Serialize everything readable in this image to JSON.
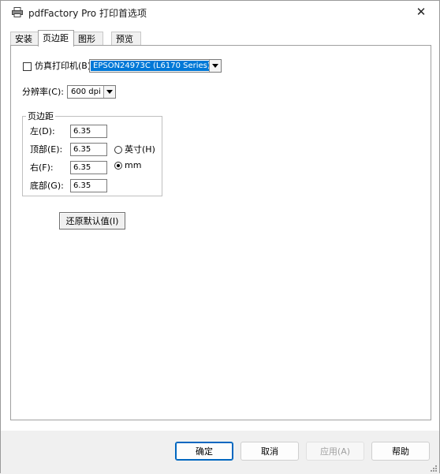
{
  "window": {
    "title": "pdfFactory Pro 打印首选项",
    "close_glyph": "✕"
  },
  "tabs": [
    {
      "label": "安装",
      "active": false
    },
    {
      "label": "页边距",
      "active": true
    },
    {
      "label": "图形",
      "active": false
    },
    {
      "label": "预览",
      "active": false
    }
  ],
  "emulate_printer": {
    "checked": false,
    "label": "仿真打印机(B)",
    "selected_printer": "EPSON24973C (L6170 Series)"
  },
  "resolution": {
    "label": "分辨率(C):",
    "value": "600 dpi"
  },
  "margins": {
    "group_title": "页边距",
    "left": {
      "label": "左(D):",
      "value": "6.35"
    },
    "top": {
      "label": "顶部(E):",
      "value": "6.35"
    },
    "right": {
      "label": "右(F):",
      "value": "6.35"
    },
    "bottom": {
      "label": "底部(G):",
      "value": "6.35"
    },
    "units": [
      {
        "label": "英寸(H)",
        "checked": false
      },
      {
        "label": "mm",
        "checked": true
      }
    ]
  },
  "restore_defaults_label": "还原默认值(I)",
  "footer": {
    "ok": "确定",
    "cancel": "取消",
    "apply": "应用(A)",
    "help": "帮助"
  },
  "colors": {
    "accent": "#0078d7",
    "default_button_border": "#0067c0"
  }
}
